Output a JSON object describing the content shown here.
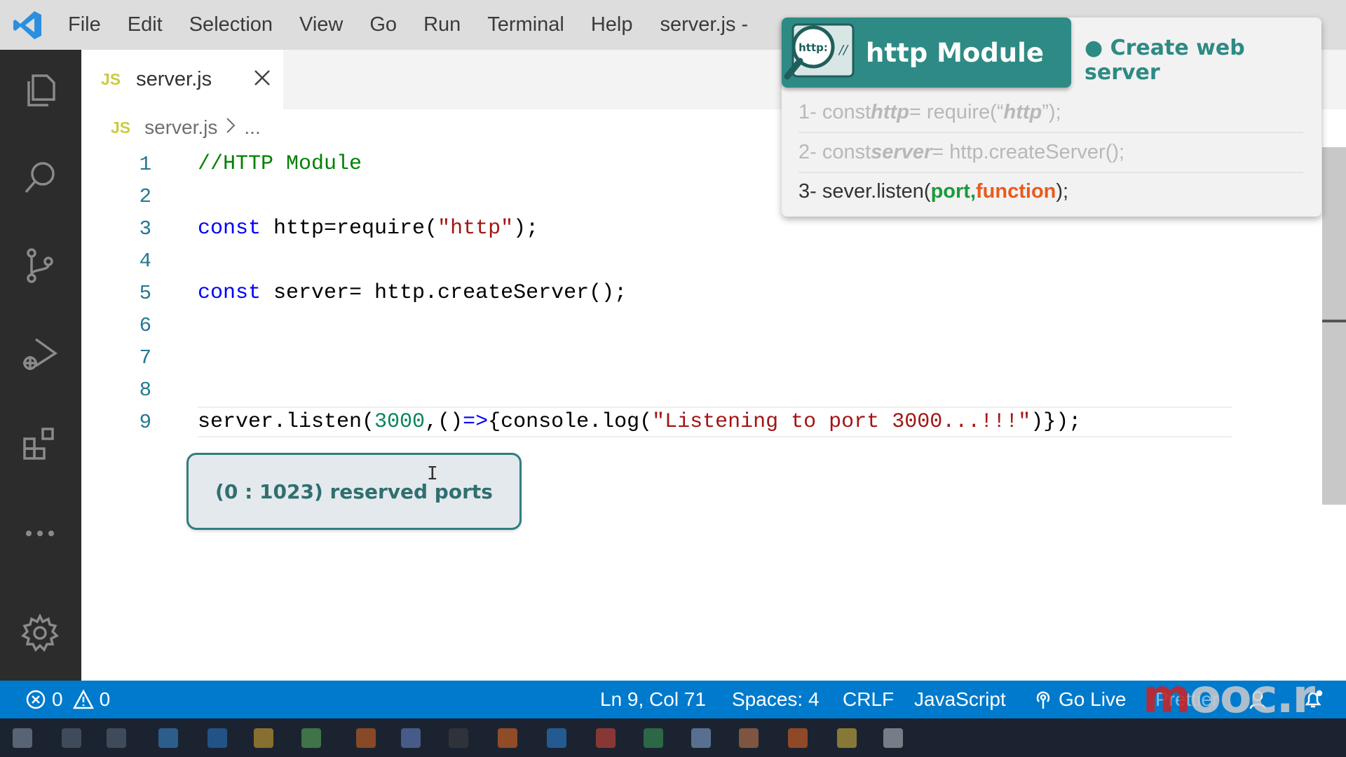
{
  "titlebar": {
    "menu": [
      "File",
      "Edit",
      "Selection",
      "View",
      "Go",
      "Run",
      "Terminal",
      "Help"
    ],
    "window_title": "server.js -"
  },
  "activitybar": {
    "icons": [
      "explorer-icon",
      "search-icon",
      "source-control-icon",
      "run-debug-icon",
      "extensions-icon",
      "more-icon",
      "settings-gear-icon"
    ]
  },
  "tab": {
    "badge": "JS",
    "label": "server.js"
  },
  "breadcrumb": {
    "badge": "JS",
    "file": "server.js",
    "rest": "..."
  },
  "code": {
    "line_numbers": [
      "1",
      "2",
      "3",
      "4",
      "5",
      "6",
      "7",
      "8",
      "9"
    ],
    "line1": "//HTTP Module",
    "line3_kw": "const",
    "line3_a": " http=require(",
    "line3_str": "\"http\"",
    "line3_b": ");",
    "line5_kw": "const",
    "line5_a": " server= http.createServer();",
    "line9_a": "server.listen(",
    "line9_num": "3000",
    "line9_b": ",()",
    "line9_arrow": "=>",
    "line9_c": "{console.log(",
    "line9_str": "\"Listening to port 3000...!!!\"",
    "line9_d": ")});"
  },
  "callout": {
    "text": "(0 : 1023) reserved ports"
  },
  "overlay": {
    "icon_text": "http:",
    "icon_slashes": "//",
    "title": "http Module",
    "bullet": "● Create web server",
    "step1_prefix": "1- const ",
    "step1_var": "http",
    "step1_mid": " = require(“",
    "step1_arg": "http",
    "step1_end": "”);",
    "step2_prefix": "2- const ",
    "step2_var": "server",
    "step2_end": "= http.createServer();",
    "step3_prefix": "3- sever.listen(",
    "step3_port": "port,",
    "step3_fn": " function",
    "step3_end": ");"
  },
  "statusbar": {
    "errors": "0",
    "warnings": "0",
    "position": "Ln 9, Col 71",
    "spaces": "Spaces: 4",
    "eol": "CRLF",
    "language": "JavaScript",
    "golive": "Go Live",
    "prettier": "Prettier"
  },
  "watermark": {
    "text_red": "m",
    "text_grey": "ooc.r"
  },
  "colors": {
    "statusbar": "#007acc",
    "activitybar": "#2c2c2c",
    "accent_teal": "#2e8a84"
  }
}
